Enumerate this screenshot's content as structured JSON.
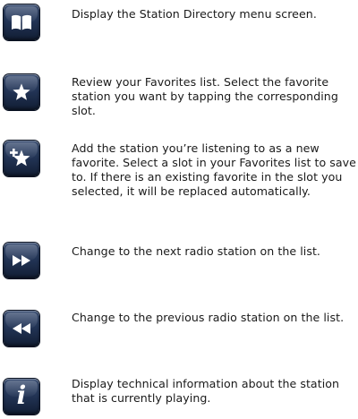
{
  "items": [
    {
      "icon": "open-book-icon",
      "text": "Display the Station Directory menu screen."
    },
    {
      "icon": "star-icon",
      "text": "Review your Favorites list. Select the favorite station you want by tapping the corresponding slot."
    },
    {
      "icon": "add-star-icon",
      "text": "Add the station you’re listening to as a new favorite. Select a slot in your Favorites list to save to. If there is an existing favorite in the slot you selected, it will be replaced automatically."
    },
    {
      "icon": "fast-forward-icon",
      "text": "Change to the next radio station on the list."
    },
    {
      "icon": "rewind-icon",
      "text": "Change to the previous radio station on the list."
    },
    {
      "icon": "info-icon",
      "glyph": "i",
      "text": "Display technical information about the station that is currently playing."
    }
  ],
  "colors": {
    "button_top": "#3b4f73",
    "button_bottom": "#111d33",
    "icon": "#ffffff",
    "text": "#1a1a1a"
  }
}
